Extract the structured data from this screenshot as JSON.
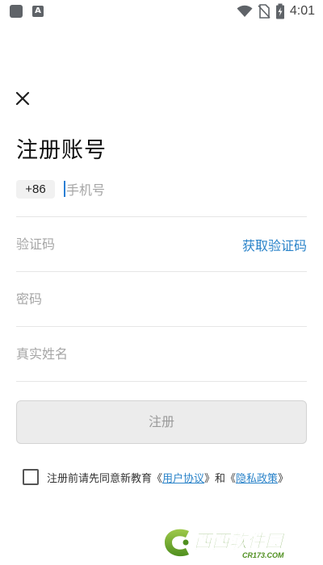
{
  "status_bar": {
    "time": "4:01",
    "left_icons": [
      "app-notification-icon",
      "a-notification-icon"
    ],
    "right_icons": [
      "wifi-icon",
      "no-sim-icon",
      "battery-charging-icon"
    ]
  },
  "header": {
    "close_icon": "close-icon"
  },
  "title": "注册账号",
  "form": {
    "country_code": "+86",
    "phone_placeholder": "手机号",
    "code_placeholder": "验证码",
    "get_code_label": "获取验证码",
    "password_placeholder": "密码",
    "name_placeholder": "真实姓名",
    "submit_label": "注册"
  },
  "agreement": {
    "prefix": "注册前请先同意新教育《",
    "user_agreement": "用户协议",
    "middle": "》和《",
    "privacy_policy": "隐私政策",
    "suffix": "》",
    "checked": false
  },
  "watermark": {
    "brand": "西西软件园",
    "domain": "CR173.COM"
  },
  "colors": {
    "link": "#2a83c9",
    "cursor": "#2a7fd4",
    "button_disabled_bg": "#ececec",
    "button_disabled_text": "#9a9a9a"
  }
}
